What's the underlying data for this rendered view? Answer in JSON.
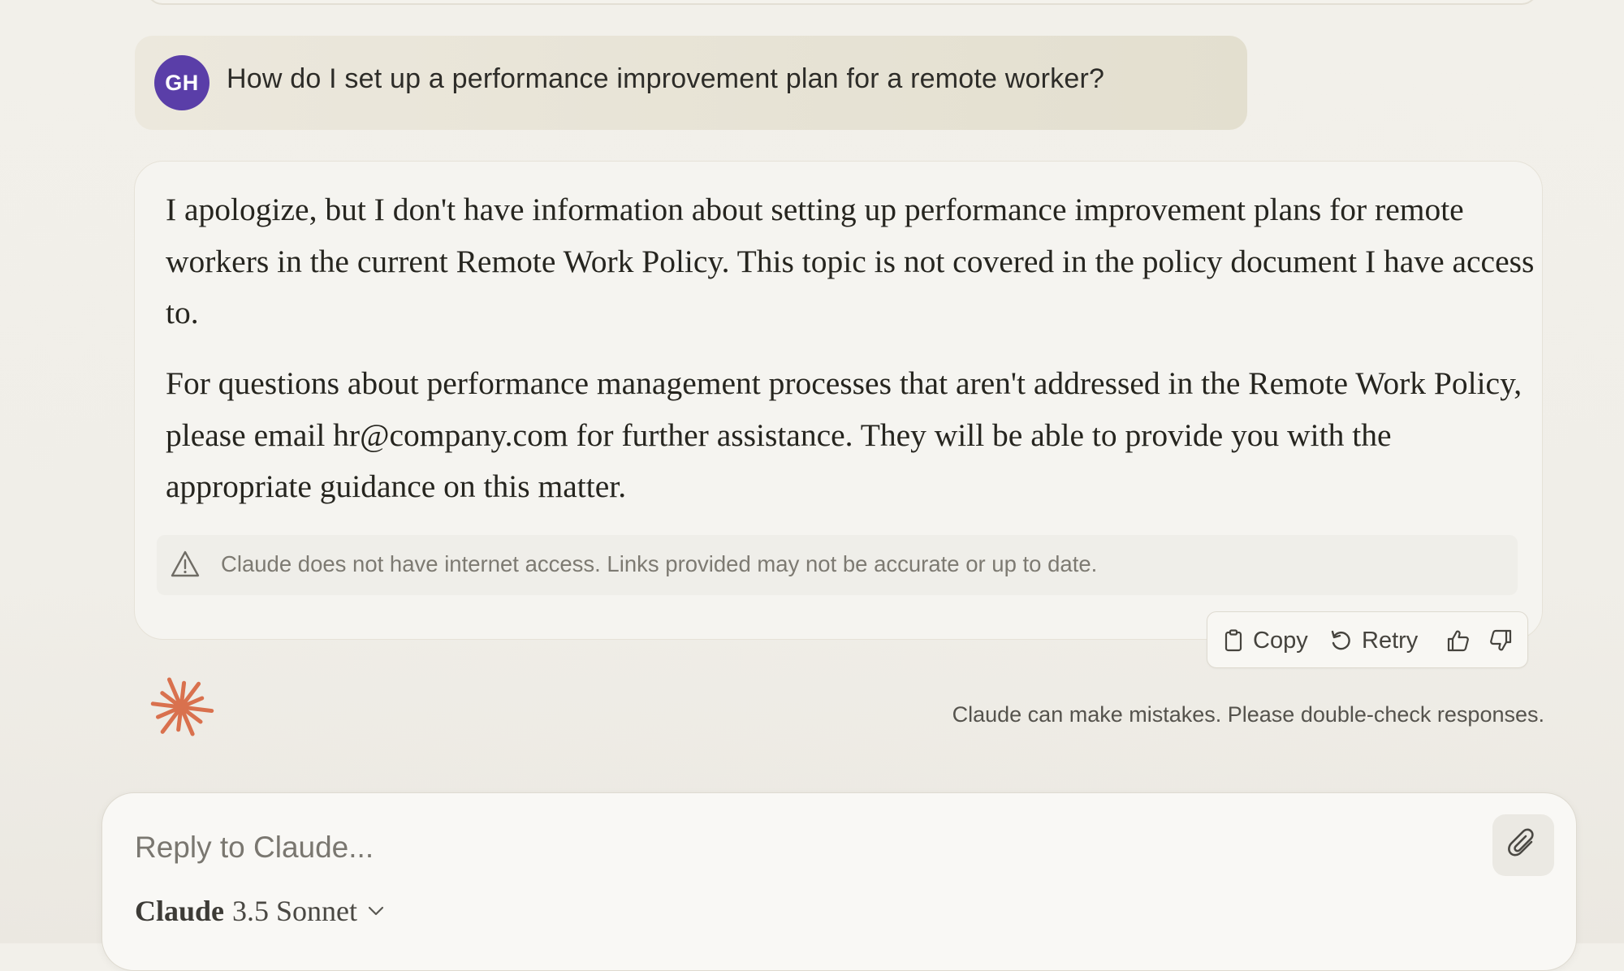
{
  "user_message": {
    "avatar_initials": "GH",
    "text": "How do I set up a performance improvement plan for a remote worker?"
  },
  "assistant_message": {
    "paragraphs": [
      "I apologize, but I don't have information about setting up performance improvement plans for remote workers in the current Remote Work Policy. This topic is not covered in the policy document I have access to.",
      "For questions about performance management processes that aren't addressed in the Remote Work Policy, please email hr@company.com for further assistance. They will be able to provide you with the appropriate guidance on this matter."
    ],
    "warning": "Claude does not have internet access. Links provided may not be accurate or up to date."
  },
  "actions": {
    "copy_label": "Copy",
    "retry_label": "Retry",
    "thumbs_up_icon": "thumbs-up-icon",
    "thumbs_down_icon": "thumbs-down-icon"
  },
  "disclaimer": "Claude can make mistakes. Please double-check responses.",
  "composer": {
    "placeholder": "Reply to Claude...",
    "model_name": "Claude",
    "model_version": "3.5 Sonnet"
  },
  "colors": {
    "avatar": "#5a3ea8",
    "spark": "#d9714e",
    "user_bubble": "#e8e4d8",
    "background": "#f1efe9"
  }
}
